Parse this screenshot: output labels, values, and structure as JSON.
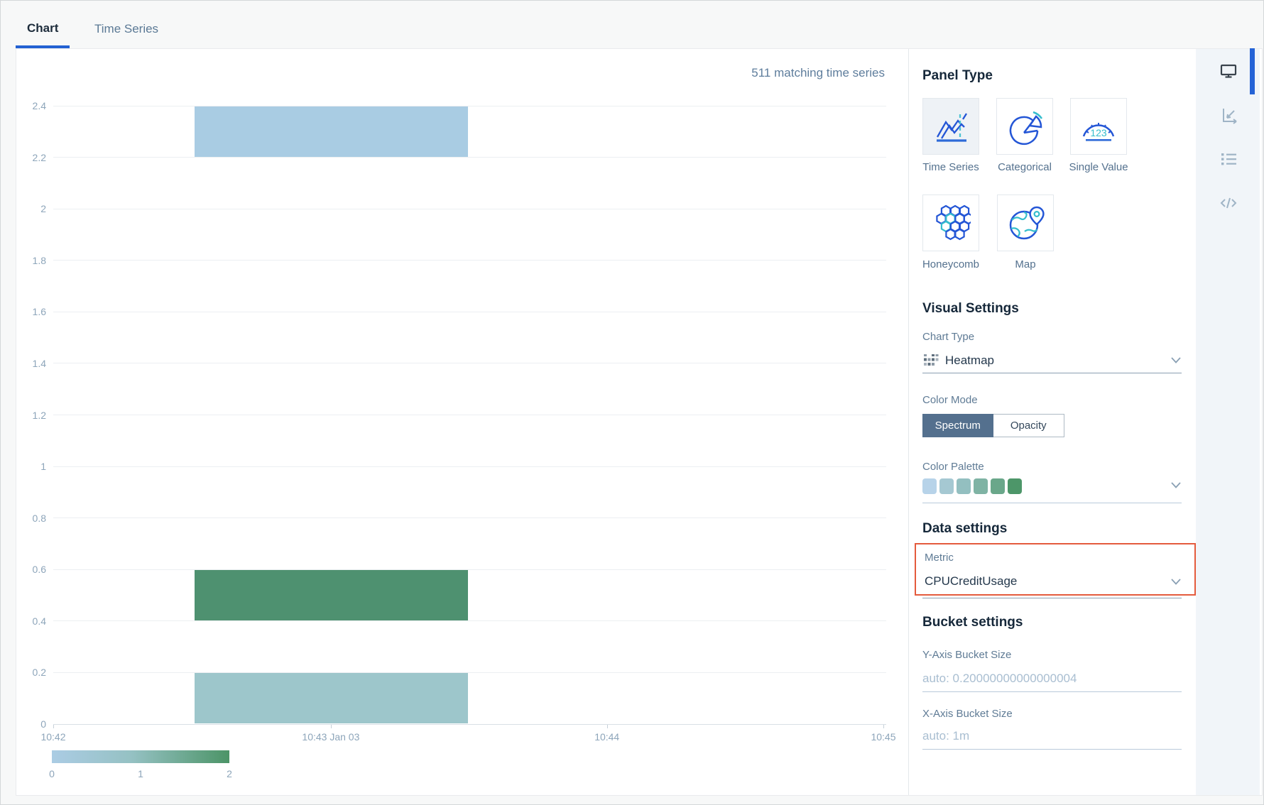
{
  "tabs": [
    {
      "label": "Chart",
      "active": true
    },
    {
      "label": "Time Series",
      "active": false
    }
  ],
  "chart_header": {
    "matching_text": "511 matching time series"
  },
  "chart_data": {
    "type": "heatmap",
    "title": "",
    "xlabel": "",
    "ylabel": "",
    "y_max": 2.4,
    "y_ticks": [
      {
        "value": 0,
        "label": "0"
      },
      {
        "value": 0.2,
        "label": "0.2"
      },
      {
        "value": 0.4,
        "label": "0.4"
      },
      {
        "value": 0.6,
        "label": "0.6"
      },
      {
        "value": 0.8,
        "label": "0.8"
      },
      {
        "value": 1,
        "label": "1"
      },
      {
        "value": 1.2,
        "label": "1.2"
      },
      {
        "value": 1.4,
        "label": "1.4"
      },
      {
        "value": 1.6,
        "label": "1.6"
      },
      {
        "value": 1.8,
        "label": "1.8"
      },
      {
        "value": 2,
        "label": "2"
      },
      {
        "value": 2.2,
        "label": "2.2"
      },
      {
        "value": 2.4,
        "label": "2.4"
      }
    ],
    "x_ticks": [
      {
        "label": "10:42",
        "frac": 0
      },
      {
        "label": "10:43 Jan 03",
        "frac": 0.3344
      },
      {
        "label": "10:44",
        "frac": 0.667
      },
      {
        "label": "10:45",
        "frac": 1
      }
    ],
    "cells": [
      {
        "y_from": 2.2,
        "y_to": 2.4,
        "x_from_frac": 0.17,
        "x_to_frac": 0.5,
        "value": 0,
        "color": "#a9cce3"
      },
      {
        "y_from": 0.4,
        "y_to": 0.6,
        "x_from_frac": 0.17,
        "x_to_frac": 0.5,
        "value": 2,
        "color": "#4e9170"
      },
      {
        "y_from": 0.0,
        "y_to": 0.2,
        "x_from_frac": 0.17,
        "x_to_frac": 0.5,
        "value": 1,
        "color": "#9dc6cb"
      }
    ],
    "colorbar": {
      "labels": [
        "0",
        "1",
        "2"
      ],
      "gradient": [
        "#abcce4",
        "#95c1c3",
        "#4c9467"
      ]
    },
    "grid": true,
    "legend_position": "bottom-left"
  },
  "panel_type": {
    "title": "Panel Type",
    "options": [
      {
        "label": "Time Series",
        "icon": "time-series-icon",
        "selected": true
      },
      {
        "label": "Categorical",
        "icon": "categorical-icon",
        "selected": false
      },
      {
        "label": "Single Value",
        "icon": "single-value-icon",
        "selected": false
      },
      {
        "label": "Honeycomb",
        "icon": "honeycomb-icon",
        "selected": false
      },
      {
        "label": "Map",
        "icon": "map-icon",
        "selected": false
      }
    ]
  },
  "visual_settings": {
    "title": "Visual Settings",
    "chart_type_label": "Chart Type",
    "chart_type_value": "Heatmap",
    "color_mode_label": "Color Mode",
    "color_mode_options": [
      "Spectrum",
      "Opacity"
    ],
    "color_mode_selected": "Spectrum",
    "color_palette_label": "Color Palette",
    "palette": [
      "#b7d3e9",
      "#a5c8d2",
      "#93bfc0",
      "#7fb3a4",
      "#6aa78a",
      "#4d9669"
    ]
  },
  "data_settings": {
    "title": "Data settings",
    "metric_label": "Metric",
    "metric_value": "CPUCreditUsage",
    "highlight_color": "#e45b3d"
  },
  "bucket_settings": {
    "title": "Bucket settings",
    "y_label": "Y-Axis Bucket Size",
    "y_value": "auto: 0.20000000000000004",
    "x_label": "X-Axis Bucket Size",
    "x_value": "auto: 1m"
  },
  "toolbar": {
    "icons": [
      "monitor-icon",
      "axes-icon",
      "list-icon",
      "code-icon"
    ],
    "active_color": "#2563d6"
  }
}
